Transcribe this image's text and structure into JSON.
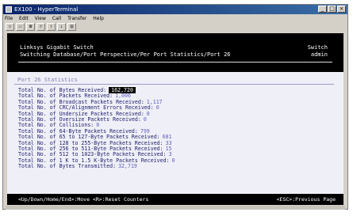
{
  "window": {
    "title": "EX100 - HyperTerminal"
  },
  "menu": [
    "File",
    "Edit",
    "View",
    "Call",
    "Transfer",
    "Help"
  ],
  "header": {
    "line1": "Linksys Gigabit Switch",
    "line2": "Switching Database/Port Perspective/Per Port Statistics/Port 26",
    "right1": "Switch",
    "right2": "admin"
  },
  "panel": {
    "title": "Port 26 Statistics",
    "stats": [
      {
        "label": "Total No. of Bytes Received:",
        "value": "162,720",
        "selected": true
      },
      {
        "label": "Total No. of Packets Received:",
        "value": "1,006"
      },
      {
        "label": "Total No. of Broadcast Packets Received:",
        "value": "1,117"
      },
      {
        "label": "Total No. of CRC/Alignment Errors Received:",
        "value": "0"
      },
      {
        "label": "Total No. of Undersize Packets Received:",
        "value": "0"
      },
      {
        "label": "Total No. of Oversize Packets Received:",
        "value": "0"
      },
      {
        "label": "Total No. of Collisions:",
        "value": "0"
      },
      {
        "label": "Total No. of 64-Byte Packets Received:",
        "value": "799"
      },
      {
        "label": "Total No. of 65 to 127-Byte Packets Received:",
        "value": "681"
      },
      {
        "label": "Total No. of 128 to 255-Byte Packets Received:",
        "value": "33"
      },
      {
        "label": "Total No. of 256 to 511-Byte Packets Received:",
        "value": "15"
      },
      {
        "label": "Total No. of 512 to 1023-Byte Packets Received:",
        "value": "3"
      },
      {
        "label": "Total No. of 1 K to 1.5 K-Byte Packets Received:",
        "value": "0"
      },
      {
        "label": "Total No. of Bytes Transmitted:",
        "value": "32,719"
      }
    ]
  },
  "bottombar": {
    "left": "<Up/Down/Home/End>:Move  <R>:Reset Counters",
    "right": "<ESC>:Previous Page"
  }
}
